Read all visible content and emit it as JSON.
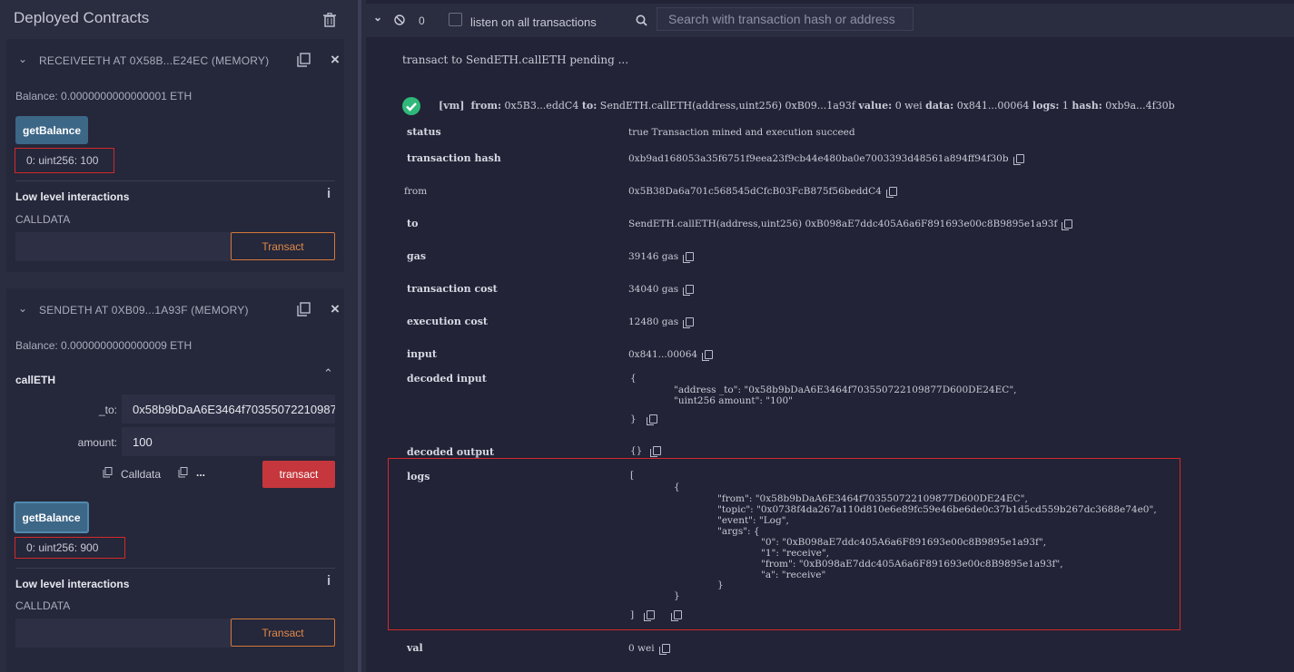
{
  "left": {
    "header_title": "Deployed Contracts",
    "c1": {
      "title": "RECEIVEETH AT 0X58B...E24EC (MEMORY)",
      "balance": "Balance: 0.0000000000000001 ETH",
      "get_balance": "getBalance",
      "output": "0: uint256: 100",
      "low_level": "Low level interactions",
      "calldata": "CALLDATA",
      "transact": "Transact"
    },
    "c2": {
      "title": "SENDETH AT 0XB09...1A93F (MEMORY)",
      "balance": "Balance: 0.0000000000000009 ETH",
      "fn_name": "callETH",
      "to_label": "_to:",
      "to_value": "0x58b9bDaA6E3464f70355072210987",
      "amount_label": "amount:",
      "amount_value": "100",
      "calldata_label": "Calldata",
      "params_label": "...",
      "transact_red": "transact",
      "get_balance": "getBalance",
      "output": "0: uint256: 900",
      "low_level": "Low level interactions",
      "calldata": "CALLDATA",
      "transact": "Transact"
    }
  },
  "terminal": {
    "counter": "0",
    "listen_label": "listen on all transactions",
    "search_placeholder": "Search with transaction hash or address",
    "pending": "transact to SendETH.callETH pending ...",
    "summary": {
      "vm": "[vm]",
      "from_k": "from:",
      "from_v": "0x5B3...eddC4",
      "to_k": "to:",
      "to_v": "SendETH.callETH(address,uint256) 0xB09...1a93f",
      "value_k": "value:",
      "value_v": "0 wei",
      "data_k": "data:",
      "data_v": "0x841...00064",
      "logs_k": "logs:",
      "logs_v": "1",
      "hash_k": "hash:",
      "hash_v": "0xb9a...4f30b"
    },
    "rows": {
      "status_k": "status",
      "status_v": "true Transaction mined and execution succeed",
      "hash_k": "transaction hash",
      "hash_v": "0xb9ad168053a35f6751f9eea23f9cb44e480ba0e7003393d48561a894ff94f30b",
      "from_k": "from",
      "from_v": "0x5B38Da6a701c568545dCfcB03FcB875f56beddC4",
      "to_k": "to",
      "to_v": "SendETH.callETH(address,uint256) 0xB098aE7ddc405A6a6F891693e00c8B9895e1a93f",
      "gas_k": "gas",
      "gas_v": "39146 gas",
      "tcost_k": "transaction cost",
      "tcost_v": "34040 gas",
      "ecost_k": "execution cost",
      "ecost_v": "12480 gas",
      "input_k": "input",
      "input_v": "0x841...00064",
      "dinput_k": "decoded input",
      "dinput_open": "{",
      "dinput_l1": "\"address _to\": \"0x58b9bDaA6E3464f703550722109877D600DE24EC\",",
      "dinput_l2": "\"uint256 amount\": \"100\"",
      "dinput_close": "}",
      "doutput_k": "decoded output",
      "doutput_v": "{}",
      "logs_k": "logs",
      "logs_l1": "[",
      "logs_l2": "{",
      "logs_l3": "\"from\": \"0x58b9bDaA6E3464f703550722109877D600DE24EC\",",
      "logs_l4": "\"topic\": \"0x0738f4da267a110d810e6e89fc59e46be6de0c37b1d5cd559b267dc3688e74e0\",",
      "logs_l5": "\"event\": \"Log\",",
      "logs_l6": "\"args\": {",
      "logs_l7": "\"0\": \"0xB098aE7ddc405A6a6F891693e00c8B9895e1a93f\",",
      "logs_l8": "\"1\": \"receive\",",
      "logs_l9": "\"from\": \"0xB098aE7ddc405A6a6F891693e00c8B9895e1a93f\",",
      "logs_l10": "\"a\": \"receive\"",
      "logs_l11": "}",
      "logs_l12": "}",
      "logs_l13": "]",
      "val_k": "val",
      "val_v": "0 wei"
    }
  }
}
